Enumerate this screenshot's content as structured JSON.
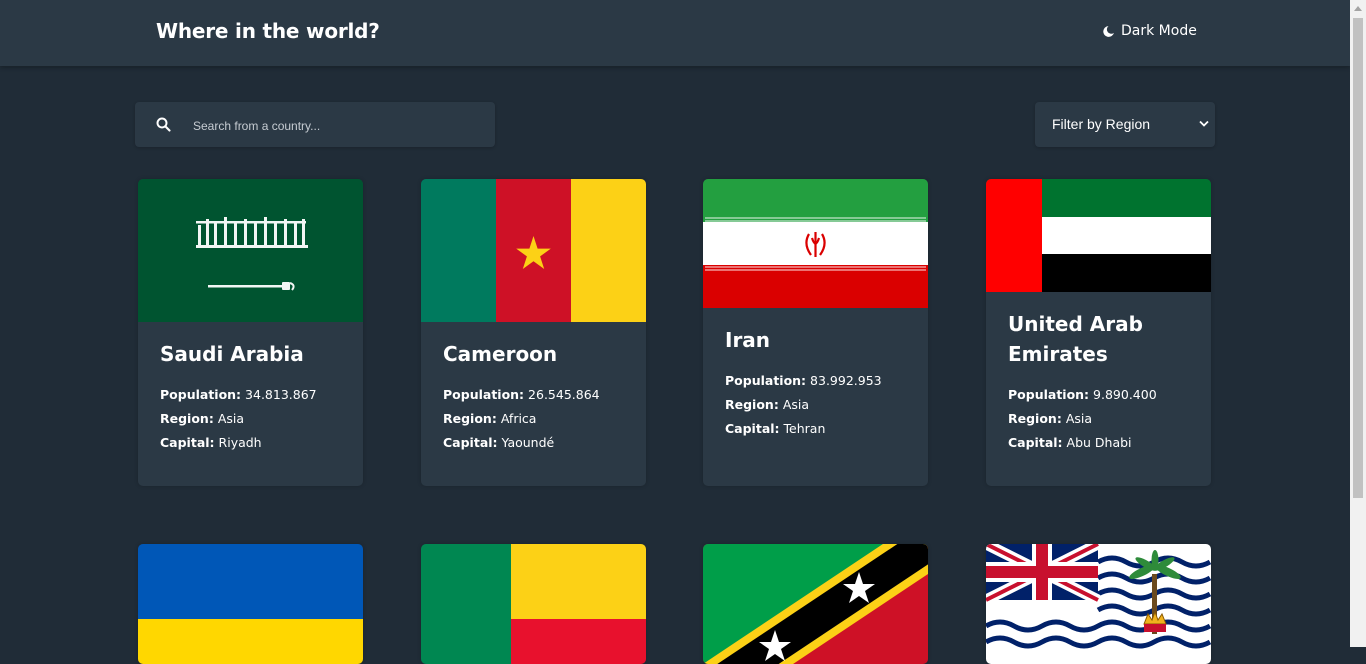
{
  "header": {
    "title": "Where in the world?",
    "mode_label": "Dark Mode",
    "mode_icon": "moon-icon"
  },
  "search": {
    "placeholder": "Search from a country...",
    "value": ""
  },
  "filter": {
    "label": "Filter by Region"
  },
  "labels": {
    "population": "Population:",
    "region": "Region:",
    "capital": "Capital:"
  },
  "countries": [
    {
      "name": "Saudi Arabia",
      "population": "34.813.867",
      "region": "Asia",
      "capital": "Riyadh"
    },
    {
      "name": "Cameroon",
      "population": "26.545.864",
      "region": "Africa",
      "capital": "Yaoundé"
    },
    {
      "name": "Iran",
      "population": "83.992.953",
      "region": "Asia",
      "capital": "Tehran"
    },
    {
      "name": "United Arab Emirates",
      "population": "9.890.400",
      "region": "Asia",
      "capital": "Abu Dhabi"
    }
  ],
  "second_row_flags": [
    "ukraine-flag",
    "benin-flag",
    "saint-kitts-and-nevis-flag",
    "british-indian-ocean-territory-flag"
  ],
  "colors": {
    "background": "#202c37",
    "elements": "#2b3945",
    "text": "#ffffff"
  }
}
